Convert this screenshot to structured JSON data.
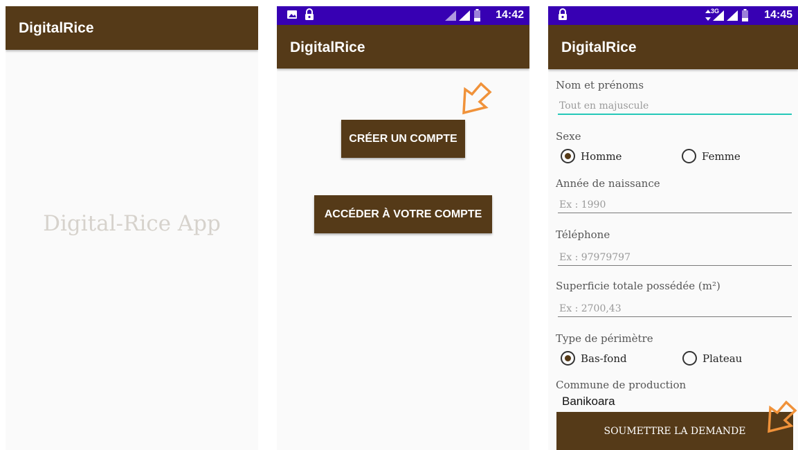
{
  "screens": [
    {
      "appbar": {
        "title": "DigitalRice"
      },
      "splash": {
        "text": "Digital-Rice App"
      }
    },
    {
      "statusbar": {
        "time": "14:42",
        "icons": [
          "image-icon",
          "lock-icon",
          "signal-icon",
          "signal-icon",
          "battery-icon"
        ]
      },
      "appbar": {
        "title": "DigitalRice"
      },
      "buttons": {
        "create_label": "CRÉER UN COMPTE",
        "access_label": "ACCÉDER À VOTRE COMPTE"
      },
      "annotation": {
        "icon": "arrow-pointer-icon",
        "color": "#f0923a"
      }
    },
    {
      "statusbar": {
        "time": "14:45",
        "network": "3G",
        "icons": [
          "lock-icon",
          "data-arrows-icon",
          "signal-icon",
          "signal-icon",
          "battery-icon"
        ]
      },
      "appbar": {
        "title": "DigitalRice"
      },
      "form": {
        "name": {
          "label": "Nom et prénoms",
          "placeholder": "Tout en majuscule"
        },
        "sex": {
          "label": "Sexe",
          "options": [
            "Homme",
            "Femme"
          ],
          "selected": "Homme"
        },
        "birth_year": {
          "label": "Année de naissance",
          "placeholder": "Ex : 1990"
        },
        "phone": {
          "label": "Téléphone",
          "placeholder": "Ex : 97979797"
        },
        "area": {
          "label": "Superficie totale possédée (m²)",
          "placeholder": "Ex : 2700,43"
        },
        "perimeter_type": {
          "label": "Type de périmètre",
          "options": [
            "Bas-fond",
            "Plateau"
          ],
          "selected": "Bas-fond"
        },
        "commune": {
          "label": "Commune de production",
          "value": "Banikoara"
        },
        "submit_label": "SOUMETTRE LA DEMANDE"
      },
      "annotation": {
        "icon": "arrow-pointer-icon",
        "color": "#f0923a"
      }
    }
  ],
  "colors": {
    "appbar": "#553a18",
    "statusbar": "#3700b3",
    "accent": "#24c8b8",
    "background": "#fafafa"
  }
}
